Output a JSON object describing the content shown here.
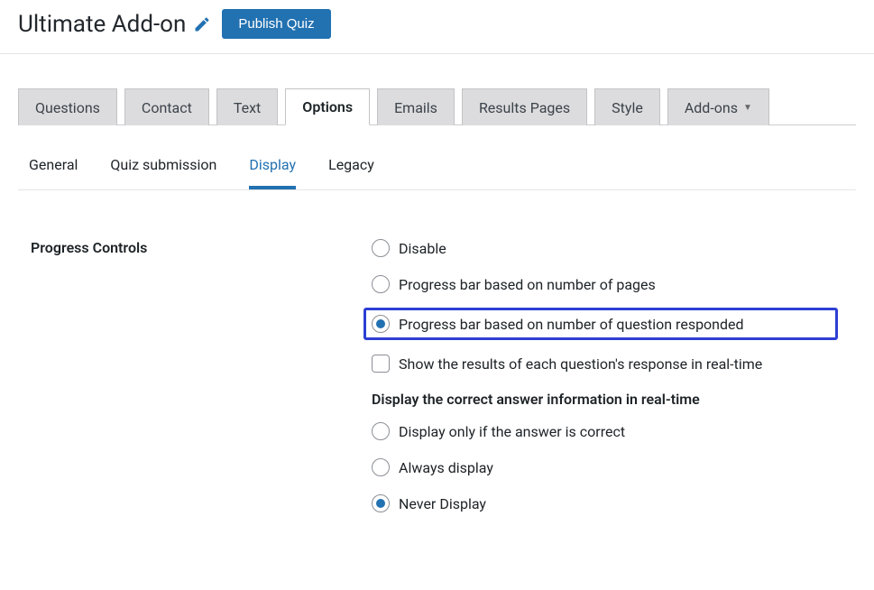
{
  "header": {
    "title": "Ultimate Add-on",
    "publish_label": "Publish Quiz"
  },
  "main_tabs": [
    {
      "label": "Questions"
    },
    {
      "label": "Contact"
    },
    {
      "label": "Text"
    },
    {
      "label": "Options"
    },
    {
      "label": "Emails"
    },
    {
      "label": "Results Pages"
    },
    {
      "label": "Style"
    },
    {
      "label": "Add-ons"
    }
  ],
  "sub_tabs": [
    {
      "label": "General"
    },
    {
      "label": "Quiz submission"
    },
    {
      "label": "Display"
    },
    {
      "label": "Legacy"
    }
  ],
  "section": {
    "progress_heading": "Progress Controls",
    "options": {
      "disable": "Disable",
      "pages": "Progress bar based on number of pages",
      "questions": "Progress bar based on number of question responded",
      "realtime_results": "Show the results of each question's response in real-time"
    },
    "answer_heading": "Display the correct answer information in real-time",
    "answer_options": {
      "correct_only": "Display only if the answer is correct",
      "always": "Always display",
      "never": "Never Display"
    }
  }
}
